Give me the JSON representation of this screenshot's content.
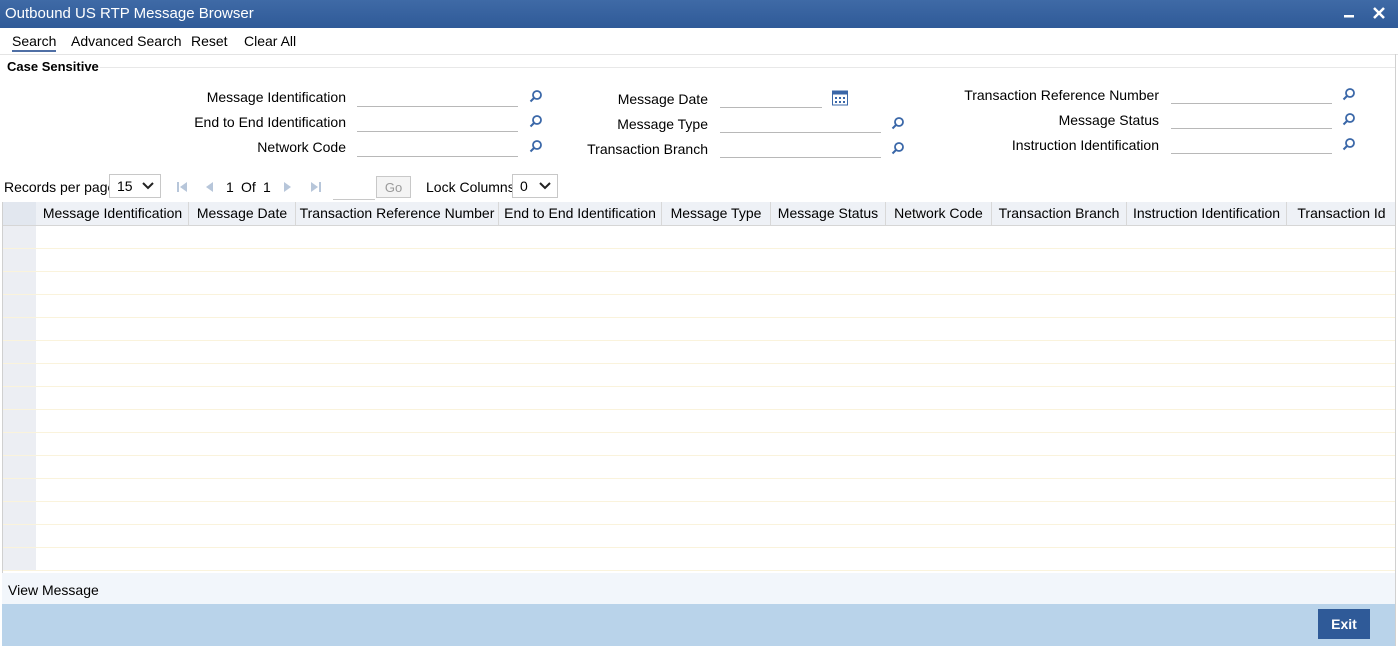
{
  "window": {
    "title": "Outbound US RTP Message Browser",
    "minimize": "▬",
    "close": "✕"
  },
  "menu": {
    "search": "Search",
    "advanced_search": "Advanced Search",
    "reset": "Reset",
    "clear_all": "Clear All"
  },
  "section": {
    "case_sensitive": "Case Sensitive"
  },
  "fields": {
    "message_identification": "Message Identification",
    "end_to_end_identification": "End to End Identification",
    "network_code": "Network Code",
    "message_date": "Message Date",
    "message_type": "Message Type",
    "transaction_branch": "Transaction Branch",
    "transaction_reference_number": "Transaction Reference Number",
    "message_status": "Message Status",
    "instruction_identification": "Instruction Identification"
  },
  "pager": {
    "records_per_page_label": "Records per page",
    "records_per_page_value": "15",
    "current_page": "1",
    "of_label": "Of",
    "total_pages": "1",
    "go_label": "Go",
    "lock_columns_label": "Lock Columns",
    "lock_columns_value": "0"
  },
  "grid": {
    "columns": [
      "Message Identification",
      "Message Date",
      "Transaction Reference Number",
      "End to End Identification",
      "Message Type",
      "Message Status",
      "Network Code",
      "Transaction Branch",
      "Instruction Identification",
      "Transaction Id"
    ],
    "row_count": 15
  },
  "footer": {
    "view_message": "View Message",
    "exit": "Exit"
  },
  "colors": {
    "title_bar": "#2f5a98",
    "footer": "#b9d3ea",
    "exit_button": "#2f5a98"
  },
  "icons": {
    "lookup": "magnifier-icon",
    "calendar": "calendar-icon"
  }
}
